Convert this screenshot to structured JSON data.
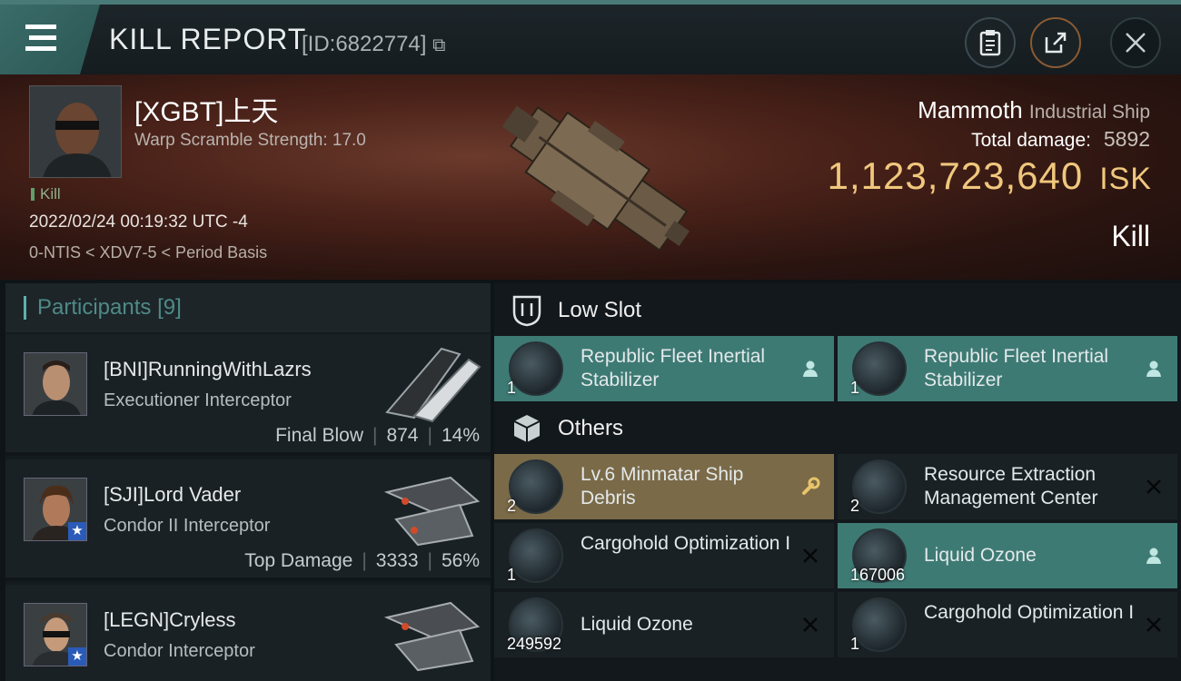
{
  "header": {
    "title": "KILL REPORT",
    "report_id": "[ID:6822774]",
    "copy_glyph": "⧉",
    "menu_icon": "hamburger-icon",
    "buttons": [
      "clipboard-icon",
      "share-icon",
      "close-icon"
    ]
  },
  "victim": {
    "name": "[XGBT]上天",
    "scramble": "Warp Scramble Strength: 17.0",
    "kill_tag": "Kill",
    "datetime": "2022/02/24 00:19:32 UTC -4",
    "location": "0-NTIS < XDV7-5 < Period Basis",
    "ship_name": "Mammoth",
    "ship_class": "Industrial Ship",
    "total_damage_label": "Total damage:",
    "total_damage": "5892",
    "isk_value": "1,123,723,640",
    "isk_unit": "ISK",
    "result": "Kill"
  },
  "participants": {
    "title": "Participants",
    "count": "[9]",
    "list": [
      {
        "name": "[BNI]RunningWithLazrs",
        "ship": "Executioner Interceptor",
        "tag": "Final Blow",
        "damage": "874",
        "percent": "14%",
        "starred": false
      },
      {
        "name": "[SJI]Lord Vader",
        "ship": "Condor II Interceptor",
        "tag": "Top Damage",
        "damage": "3333",
        "percent": "56%",
        "starred": true
      },
      {
        "name": "[LEGN]Cryless",
        "ship": "Condor Interceptor",
        "tag": "",
        "damage": "",
        "percent": "",
        "starred": true
      }
    ]
  },
  "sections": {
    "low_slot": "Low Slot",
    "others": "Others"
  },
  "modules": {
    "low": [
      {
        "name": "Republic Fleet Inertial Stabilizer",
        "qty": "1",
        "state": "teal",
        "action": "person-icon"
      },
      {
        "name": "Republic Fleet Inertial Stabilizer",
        "qty": "1",
        "state": "teal",
        "action": "person-icon"
      }
    ],
    "others": [
      {
        "name": "Lv.6 Minmatar Ship Debris",
        "qty": "2",
        "state": "gold",
        "action": "wrench-icon"
      },
      {
        "name": "Resource Extraction Management Center",
        "qty": "2",
        "state": "dark",
        "action": "destroyed-icon"
      },
      {
        "name": "Cargohold Optimization I",
        "qty": "1",
        "state": "dark",
        "action": "destroyed-icon"
      },
      {
        "name": "Liquid Ozone",
        "qty": "167006",
        "state": "teal",
        "action": "person-icon"
      },
      {
        "name": "Liquid Ozone",
        "qty": "249592",
        "state": "dark",
        "action": "destroyed-icon"
      },
      {
        "name": "Cargohold Optimization I",
        "qty": "1",
        "state": "dark",
        "action": "destroyed-icon"
      }
    ]
  },
  "colors": {
    "accent_teal": "#3e7a74",
    "isk_gold": "#f0c77d",
    "dropped_gold": "#7a6a48"
  }
}
